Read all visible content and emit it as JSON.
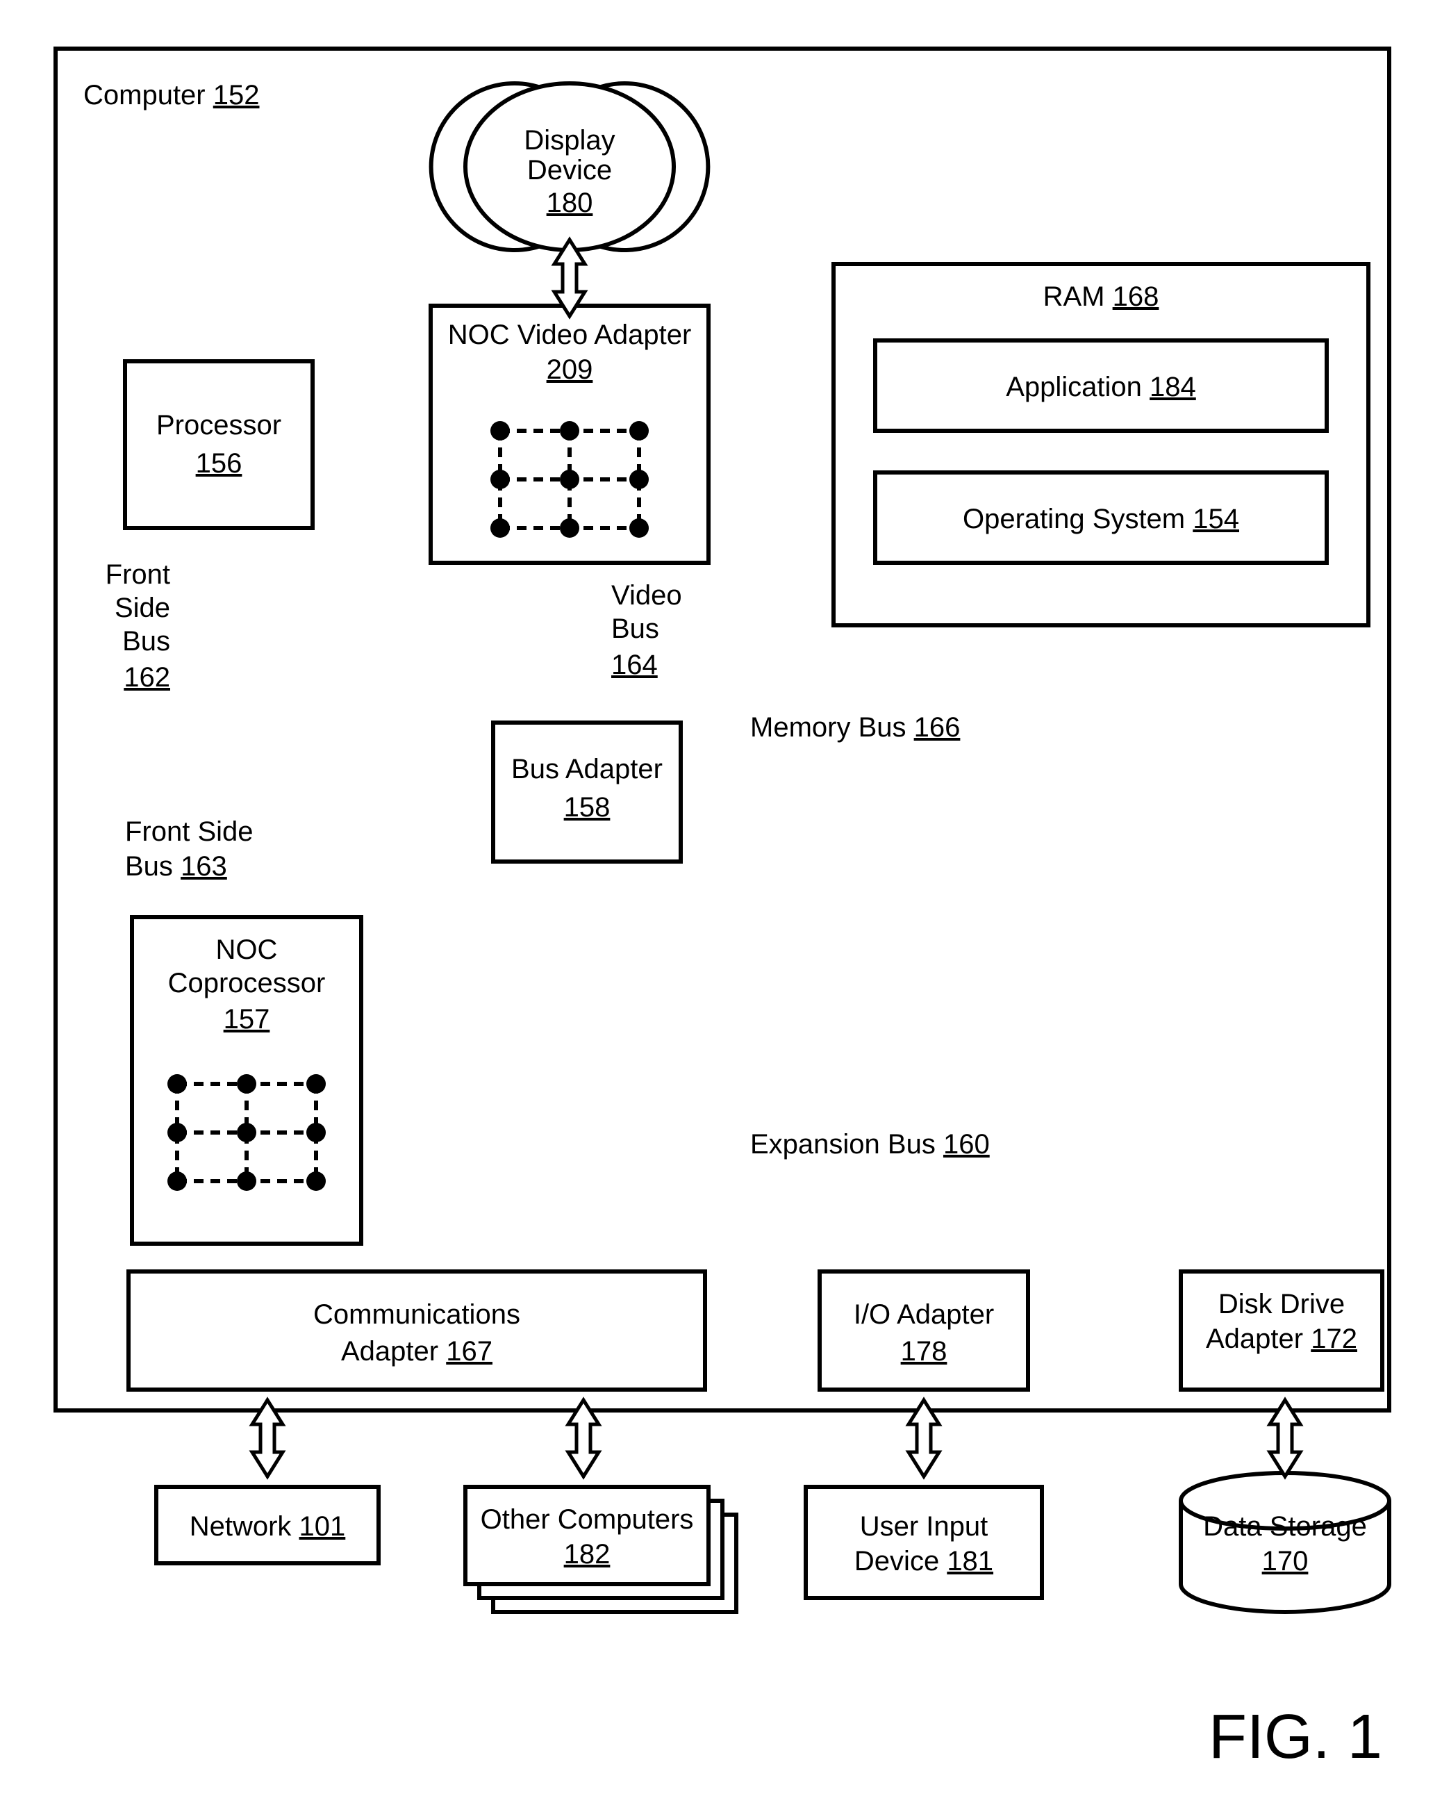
{
  "figure_label": "FIG. 1",
  "computer": {
    "label": "Computer",
    "ref": "152"
  },
  "display": {
    "label": "Display Device",
    "ref": "180"
  },
  "noc_video": {
    "label": "NOC Video Adapter",
    "ref": "209"
  },
  "processor": {
    "label": "Processor",
    "ref": "156"
  },
  "ram": {
    "label": "RAM",
    "ref": "168"
  },
  "application": {
    "label": "Application",
    "ref": "184"
  },
  "os": {
    "label": "Operating System",
    "ref": "154"
  },
  "bus_adapter": {
    "label": "Bus Adapter",
    "ref": "158"
  },
  "noc_coproc": {
    "label": "NOC Coprocessor",
    "ref": "157"
  },
  "comm_adapter": {
    "label": "Communications Adapter",
    "ref": "167"
  },
  "io_adapter": {
    "label": "I/O Adapter",
    "ref": "178"
  },
  "disk_adapter_l1": "Disk Drive",
  "disk_adapter_l2": "Adapter",
  "disk_adapter_ref": "172",
  "network": {
    "label": "Network",
    "ref": "101"
  },
  "other_comp": {
    "label": "Other Computers",
    "ref": "182"
  },
  "user_input_l1": "User Input",
  "user_input_l2": "Device",
  "user_input_ref": "181",
  "data_storage": {
    "label": "Data Storage",
    "ref": "170"
  },
  "fsb": {
    "l1": "Front",
    "l2": "Side",
    "l3": "Bus",
    "ref": "162"
  },
  "fsb2": {
    "l1": "Front Side",
    "l2": "Bus",
    "ref": "163"
  },
  "video_bus": {
    "l1": "Video",
    "l2": "Bus",
    "ref": "164"
  },
  "mem_bus": {
    "label": "Memory Bus",
    "ref": "166"
  },
  "exp_bus": {
    "label": "Expansion Bus",
    "ref": "160"
  }
}
